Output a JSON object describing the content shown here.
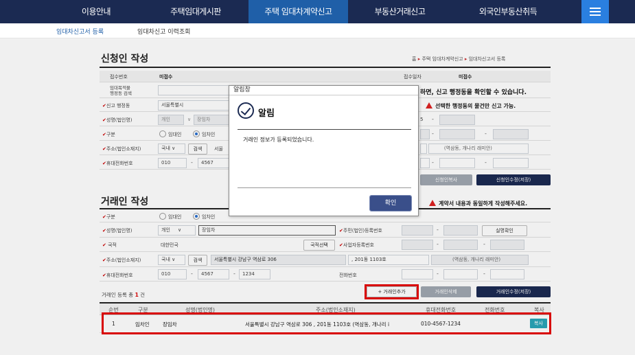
{
  "nav": {
    "items": [
      "이용안내",
      "주택임대게시판",
      "주택 임대차계약신고",
      "부동산거래신고",
      "외국인부동산취득"
    ]
  },
  "subnav": {
    "items": [
      "임대차신고서 등록",
      "임대차신고 이력조회"
    ]
  },
  "applicant": {
    "title": "신청인 작성",
    "breadcrumb": [
      "홈",
      "주택 임대차계약신고",
      "임대차신고서 등록"
    ],
    "receipt_no_label": "접수번호",
    "receipt_no": "미접수",
    "receipt_date_label": "접수일자",
    "receipt_date": "미접수",
    "dong_search_label_1": "임대목적물",
    "dong_search_label_2": "행정동 검색",
    "dong_hint": "하면, 신고 행정동을 확인할 수 있습니다.",
    "report_dong_label": "신고 행정동",
    "report_dong": "서울특별시",
    "report_warn": "선택한 행정동의 물건만 신고 가능.",
    "name_label": "성명(법인명)",
    "name_type": "개인",
    "name": "장임차",
    "id_digit": "5",
    "type_label": "구분",
    "type_opt1": "임대인",
    "type_opt2": "임차인",
    "addr_label": "주소(법인소재지)",
    "addr_domestic": "국내",
    "addr_search": "검색",
    "addr_city": "서울",
    "addr_extra": "(역삼동, 개나리 래미안)",
    "phone_label": "휴대전화번호",
    "phone1": "010",
    "phone2": "4567",
    "btn_copy_applicant": "신청인복사",
    "btn_modify_applicant": "신청인수정(저장)"
  },
  "party": {
    "title": "거래인 작성",
    "warn": "계약서 내용과 동일하게 작성해주세요.",
    "type_label": "구분",
    "type_opt1": "임대인",
    "type_opt2": "임차인",
    "name_label": "성명(법인명)",
    "name_type": "개인",
    "name": "장임차",
    "jumin_label": "주민(법인)등록번호",
    "btn_verify": "실명확인",
    "nation_label": "국적",
    "nation": "대한민국",
    "btn_nation": "국적선택",
    "bizno_label": "사업자등록번호",
    "addr_label": "주소(법인소재지)",
    "addr_domestic": "국내",
    "addr_search": "검색",
    "addr": "서울특별시 강남구 역삼로 306",
    "addr_detail": ", 201동 1103호",
    "addr_extra": "(역삼동, 개나리 래미안)",
    "phone_label": "휴대전화번호",
    "phone1": "010",
    "phone2": "4567",
    "phone3": "1234",
    "tel_label": "전화번호",
    "count_prefix": "거래인 등록 총",
    "count": "1",
    "count_suffix": "건",
    "btn_add": "+ 거래인추가",
    "btn_delete": "거래인삭제",
    "btn_modify": "거래인수정(저장)"
  },
  "table": {
    "headers": [
      "순번",
      "구분",
      "성명(법인명)",
      "주소(법인소재지)",
      "휴대전화번호",
      "전화번호",
      "복사"
    ],
    "rows": [
      {
        "no": "1",
        "type": "임차인",
        "name": "장임차",
        "addr": "서울특별시 강남구 역삼로 306 , 201동 1103호  (역삼동, 개나리 i",
        "mobile": "010-4567-1234",
        "tel": "",
        "copy": "복사"
      }
    ]
  },
  "dialog": {
    "window_title": "알림창",
    "heading": "알림",
    "message": "거래인 정보가 등록되었습니다.",
    "ok": "확인"
  },
  "colors": {
    "nav_bg": "#1b2a52",
    "nav_active": "#1f5fa8",
    "highlight": "#e60000",
    "copy_btn": "#2aa5b8"
  }
}
